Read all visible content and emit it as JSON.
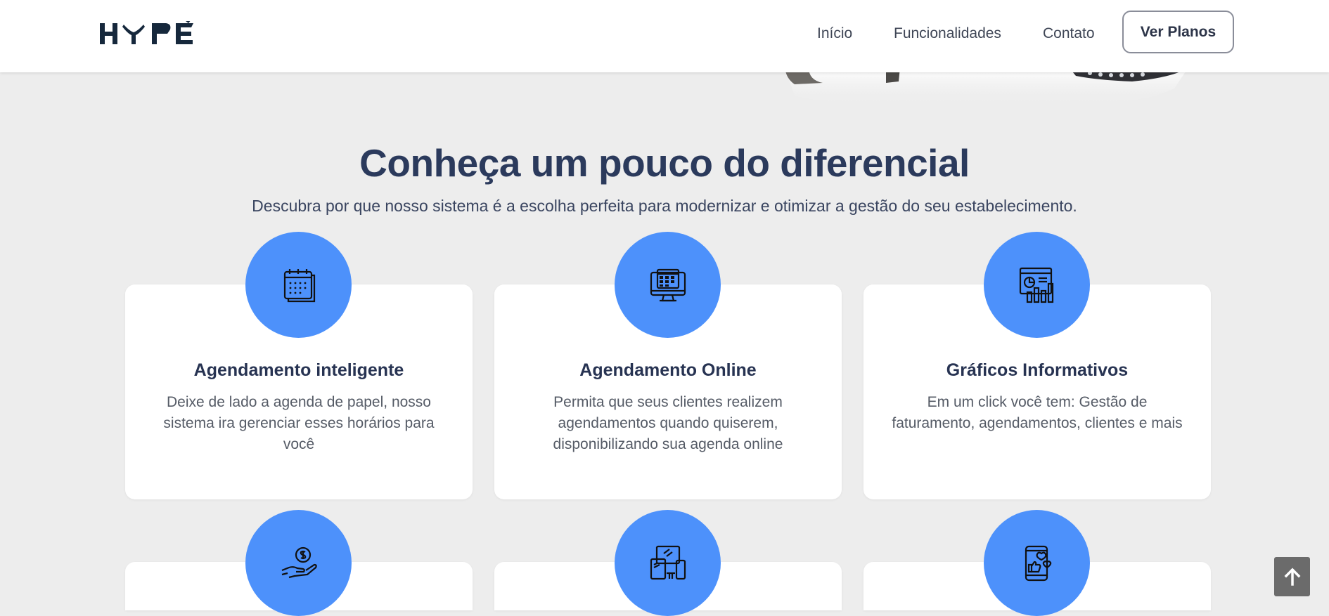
{
  "header": {
    "logo_text": "HYPE",
    "nav": [
      {
        "label": "Início"
      },
      {
        "label": "Funcionalidades"
      },
      {
        "label": "Contato"
      }
    ],
    "plans_button": "Ver Planos"
  },
  "section": {
    "title": "Conheça um pouco do diferencial",
    "subtitle": "Descubra por que nosso sistema é a escolha perfeita para modernizar e otimizar a gestão do seu estabelecimento."
  },
  "features": [
    {
      "icon": "calendar-icon",
      "title": "Agendamento inteligente",
      "description": "Deixe de lado a agenda de papel, nosso sistema ira gerenciar esses horários para você"
    },
    {
      "icon": "monitor-calendar-icon",
      "title": "Agendamento Online",
      "description": "Permita que seus clientes realizem agendamentos quando quiserem, disponibilizando sua agenda online"
    },
    {
      "icon": "analytics-chart-icon",
      "title": "Gráficos Informativos",
      "description": "Em um click você tem: Gestão de faturamento, agendamentos, clientes e mais"
    },
    {
      "icon": "hand-coin-icon",
      "title": "",
      "description": ""
    },
    {
      "icon": "multi-device-icon",
      "title": "",
      "description": ""
    },
    {
      "icon": "phone-likes-icon",
      "title": "",
      "description": ""
    }
  ],
  "colors": {
    "accent": "#4d91fb",
    "background": "#ededed",
    "heading": "#2b3a5c"
  },
  "scroll_top_icon": "arrow-up-icon"
}
